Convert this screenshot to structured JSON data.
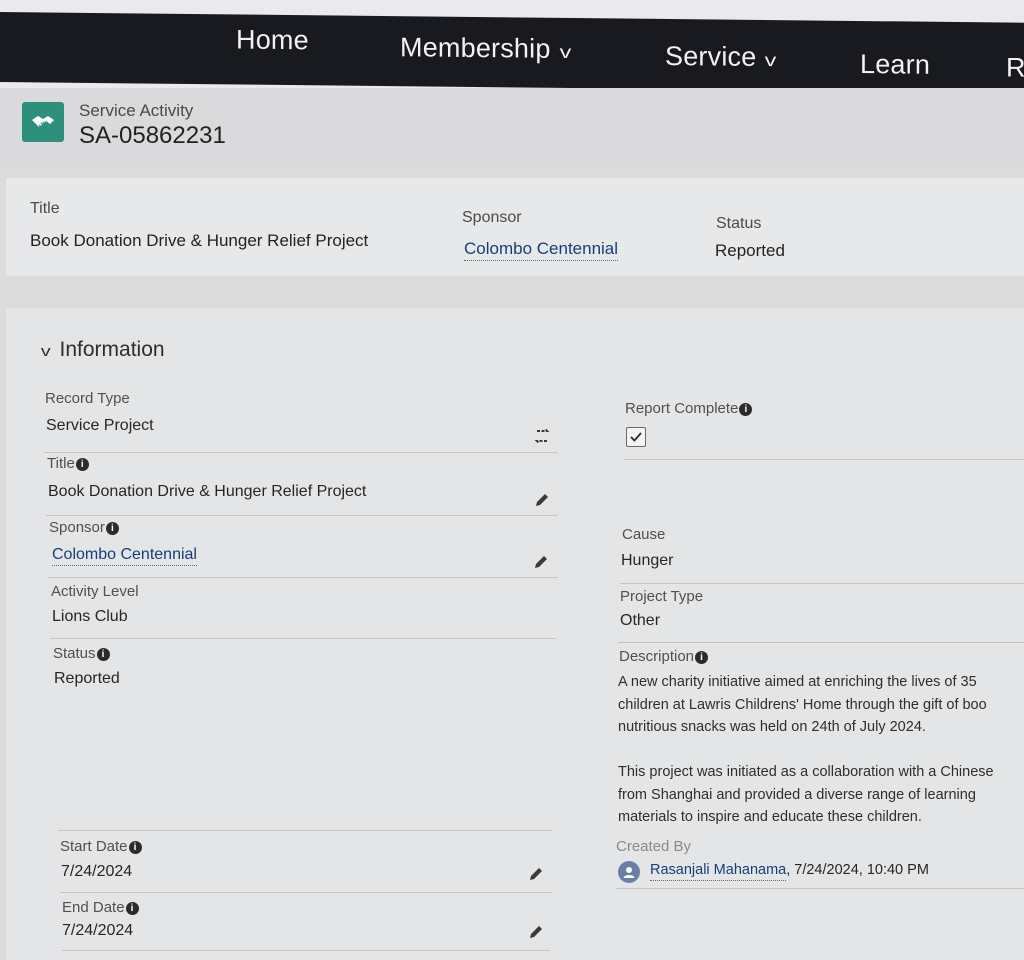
{
  "nav": {
    "items": [
      {
        "label": "Home"
      },
      {
        "label": "Membership"
      },
      {
        "label": "Service"
      },
      {
        "label": "Learn"
      },
      {
        "label": "R"
      }
    ]
  },
  "header": {
    "object_label": "Service Activity",
    "record_id": "SA-05862231"
  },
  "highlights": {
    "title_label": "Title",
    "title_value": "Book Donation Drive & Hunger Relief Project",
    "sponsor_label": "Sponsor",
    "sponsor_value": "Colombo Centennial",
    "status_label": "Status",
    "status_value": "Reported"
  },
  "section": {
    "title": "Information"
  },
  "fields": {
    "record_type_label": "Record Type",
    "record_type_value": "Service Project",
    "title_label": "Title",
    "title_value": "Book Donation Drive & Hunger Relief Project",
    "sponsor_label": "Sponsor",
    "sponsor_value": "Colombo Centennial",
    "activity_level_label": "Activity Level",
    "activity_level_value": "Lions Club",
    "status_label": "Status",
    "status_value": "Reported",
    "start_date_label": "Start Date",
    "start_date_value": "7/24/2024",
    "end_date_label": "End Date",
    "end_date_value": "7/24/2024",
    "report_complete_label": "Report Complete",
    "report_complete_checked": true,
    "cause_label": "Cause",
    "cause_value": "Hunger",
    "project_type_label": "Project Type",
    "project_type_value": "Other",
    "description_label": "Description",
    "description_lines": [
      "A new charity initiative aimed at enriching the lives of 35",
      "children at Lawris Childrens' Home through the gift of boo",
      "nutritious snacks was held on 24th of July 2024.",
      "",
      "This project was initiated as a collaboration with a Chinese",
      "from Shanghai and provided a diverse range of learning",
      "materials to inspire and educate these children."
    ],
    "created_by_label": "Created By",
    "created_by_user": "Rasanjali Mahanama",
    "created_by_timestamp": ", 7/24/2024, 10:40 PM"
  },
  "colors": {
    "nav_background": "#181a1f",
    "record_icon": "#2e8f7c",
    "link": "#163f7a"
  },
  "icons": [
    "handshake-icon",
    "chevron-down-icon",
    "pencil-icon",
    "info-icon",
    "change-record-type-icon",
    "checkbox-checked-icon",
    "user-avatar-icon"
  ]
}
